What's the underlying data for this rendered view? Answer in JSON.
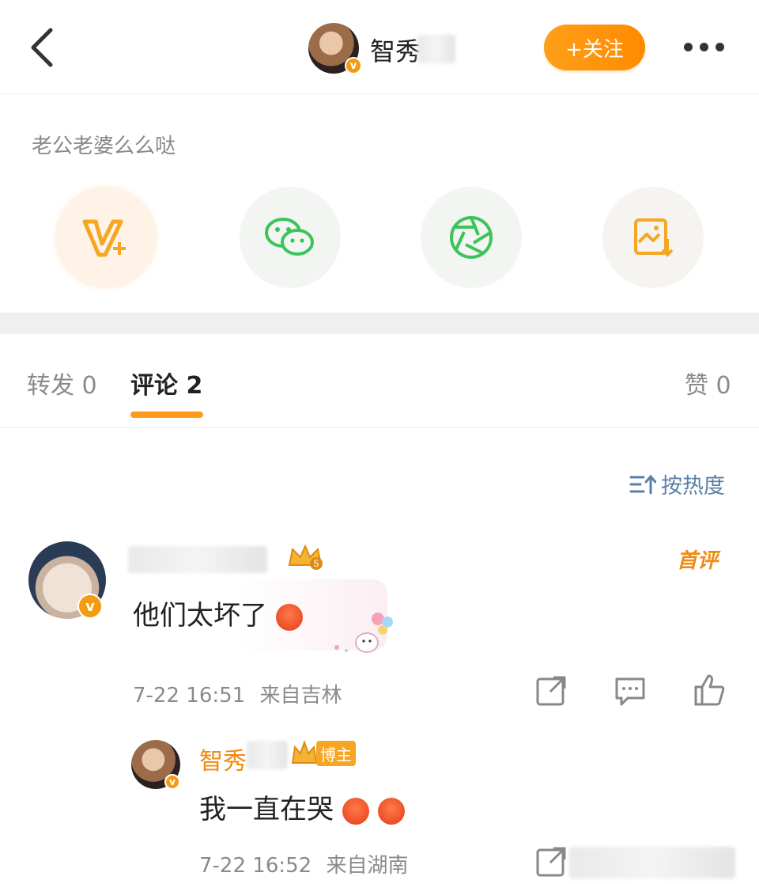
{
  "header": {
    "username": "智秀",
    "follow_label": "+关注",
    "verified_badge": "v"
  },
  "share": {
    "prompt_text": "老公老婆么么哒",
    "items": [
      {
        "icon": "vplus-icon",
        "color": "#f5a623"
      },
      {
        "icon": "wechat-icon",
        "color": "#3cc45a"
      },
      {
        "icon": "moments-icon",
        "color": "#3cc45a"
      },
      {
        "icon": "save-image-icon",
        "color": "#f5a623"
      }
    ]
  },
  "tabs": {
    "repost": "转发 0",
    "comments": "评论 2",
    "likes": "赞 0"
  },
  "sort": {
    "label": "按热度"
  },
  "comments": [
    {
      "text": "他们太坏了",
      "first_badge": "首评",
      "time": "7-22 16:51",
      "location": "来自吉林",
      "level_badge": "5"
    }
  ],
  "reply": {
    "name": "智秀",
    "badge": "博主",
    "text": "我一直在哭",
    "time": "7-22 16:52",
    "location": "来自湖南"
  },
  "colors": {
    "accent": "#ff9a1a",
    "link": "#5b7fa8",
    "muted": "#8a8a8a"
  }
}
